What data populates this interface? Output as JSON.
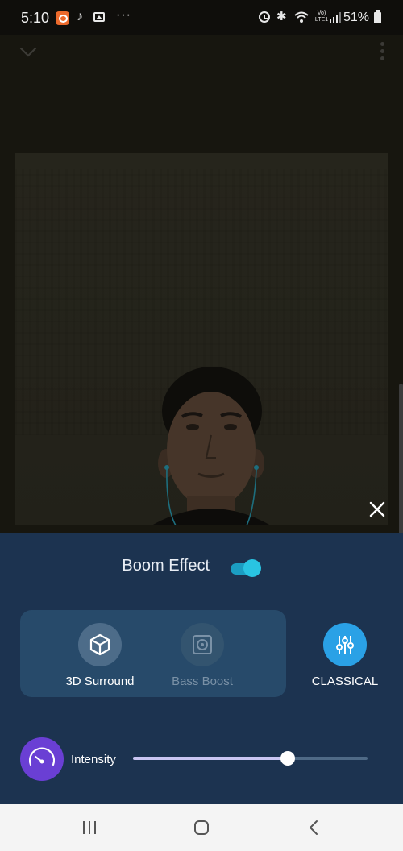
{
  "status_bar": {
    "time": "5:10",
    "lte_label_top": "Vo)",
    "lte_label_bottom": "LTE1",
    "battery_percent": "51%",
    "icons": [
      "app-notification-icon",
      "music-note-icon",
      "image-icon",
      "more-dots-icon",
      "alarm-icon",
      "bluetooth-icon",
      "wifi-icon",
      "signal-icon",
      "battery-icon"
    ]
  },
  "player": {
    "icons": [
      "chevron-down-icon",
      "overflow-menu-icon",
      "close-icon"
    ]
  },
  "effects": {
    "boom_label": "Boom Effect",
    "boom_enabled": true,
    "surround_label": "3D Surround",
    "surround_active": true,
    "bass_label": "Bass Boost",
    "bass_active": false,
    "eq_label": "CLASSICAL",
    "intensity_label": "Intensity",
    "intensity_level": 0.66,
    "colors": {
      "panel": "#1c3350",
      "toggle_on": "#29c4e2",
      "eq_button": "#2aa1e6",
      "intensity_knob": "#6a3fd4",
      "slider_fill": "#c9c5f2"
    }
  },
  "navigation": {
    "icons": [
      "recent-apps-icon",
      "home-icon",
      "back-icon"
    ]
  }
}
